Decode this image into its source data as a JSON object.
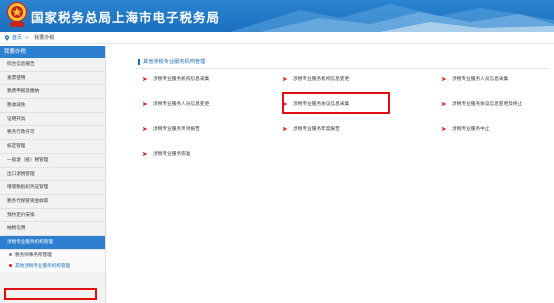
{
  "header": {
    "site_title": "国家税务总局上海市电子税务局"
  },
  "breadcrumb": {
    "home": "首页",
    "separator": ">",
    "current": "我要办税"
  },
  "sidebar": {
    "title": "我要办税",
    "items": [
      {
        "label": "综合信息报告"
      },
      {
        "label": "发票使用"
      },
      {
        "label": "税费申报及缴纳"
      },
      {
        "label": "税收减免"
      },
      {
        "label": "证明开具"
      },
      {
        "label": "税务行政许可"
      },
      {
        "label": "核定管理"
      },
      {
        "label": "一般退（抵）税管理"
      },
      {
        "label": "出口退税管理"
      },
      {
        "label": "增值税抵扣凭证管理"
      },
      {
        "label": "税务代保管资金收取"
      },
      {
        "label": "预约定价安排"
      },
      {
        "label": "纳税信用"
      },
      {
        "label": "涉税专业服务机构管理"
      }
    ],
    "subitems": [
      {
        "label": "税务师事务所管理"
      },
      {
        "label": "其他涉税专业服务机构管理"
      }
    ]
  },
  "main": {
    "section_title": "其他涉税专业服务机构管理",
    "functions": [
      {
        "label": "涉税专业服务机构信息采集"
      },
      {
        "label": "涉税专业服务机构信息变更"
      },
      {
        "label": "涉税专业服务人员信息采集"
      },
      {
        "label": "涉税专业服务人员信息变更"
      },
      {
        "label": "涉税专业服务协议信息采集"
      },
      {
        "label": "涉税专业服务协议信息变更及终止"
      },
      {
        "label": "涉税专业服务专项报告"
      },
      {
        "label": "涉税专业服务年度报告"
      },
      {
        "label": "涉税专业服务中止"
      },
      {
        "label": "涉税专业服务恢复"
      }
    ]
  },
  "colors": {
    "brand_blue": "#1c70bf",
    "highlight_red": "#e01010",
    "arrow_red": "#e02020"
  }
}
